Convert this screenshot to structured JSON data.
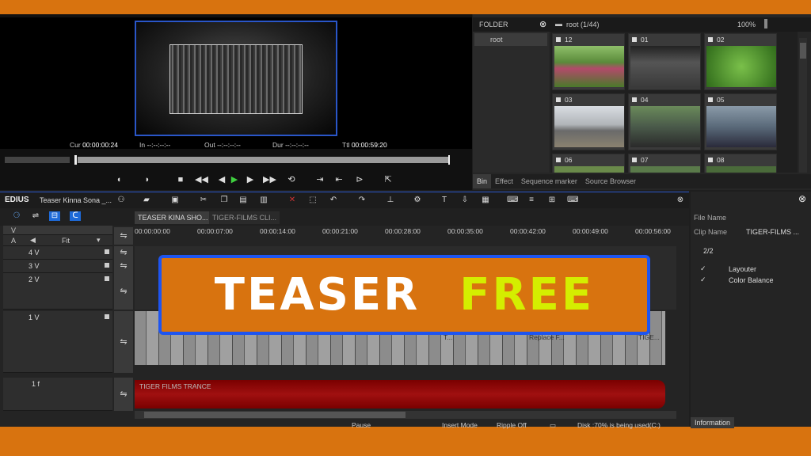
{
  "player": {
    "timecodes": {
      "cur_label": "Cur",
      "cur_value": "00:00:00:24",
      "in_label": "In",
      "in_value": "--:--:--:--",
      "out_label": "Out",
      "out_value": "--:--:--:--",
      "dur_label": "Dur",
      "dur_value": "--:--:--:--",
      "ttl_label": "Ttl",
      "ttl_value": "00:00:59:20"
    }
  },
  "bin": {
    "folder_header": "FOLDER",
    "path_header": "root (1/44)",
    "zoom": "100%",
    "tree_root": "root",
    "clips": [
      "12",
      "01",
      "02",
      "03",
      "04",
      "05",
      "06",
      "07",
      "08"
    ],
    "tabs": [
      "Bin",
      "Effect",
      "Sequence marker",
      "Source Browser"
    ]
  },
  "timeline": {
    "brand": "EDIUS",
    "project": "Teaser Kinna Sona _...",
    "seq_tabs": [
      "TEASER KINA SHO...",
      "TIGER-FILMS CLI..."
    ],
    "ruler": [
      "00:00:00:00",
      "00:00:07:00",
      "00:00:14:00",
      "00:00:21:00",
      "00:00:28:00",
      "00:00:35:00",
      "00:00:42:00",
      "00:00:49:00",
      "00:00:56:00"
    ],
    "fit_label": "Fit",
    "tracks": {
      "v4": "4 V",
      "v3": "3 V",
      "v2": "2 V",
      "v1": "1 V",
      "a1": "1 f",
      "v_label": "V",
      "a_label": "A"
    },
    "clip_labels": {
      "c1": "T...",
      "c2": "Replace F...",
      "c3": "TIGE..."
    },
    "audio_label": "TIGER FILMS TRANCE",
    "status": {
      "pause": "Pause",
      "insert": "Insert Mode",
      "ripple": "Ripple Off",
      "disk": "Disk :70% is being used(C:)"
    }
  },
  "info": {
    "file_name_label": "File Name",
    "clip_name_label": "Clip Name",
    "clip_name_value": "TIGER-FILMS ...",
    "count": "2/2",
    "effects": [
      "Layouter",
      "Color Balance"
    ],
    "tab": "Information"
  },
  "banner": {
    "word1": "TEASER",
    "word2": "FREE"
  },
  "colors": {
    "accent_blue": "#1e55f0",
    "frame_orange": "#d8730f",
    "free_yellow": "#d4ee00"
  }
}
